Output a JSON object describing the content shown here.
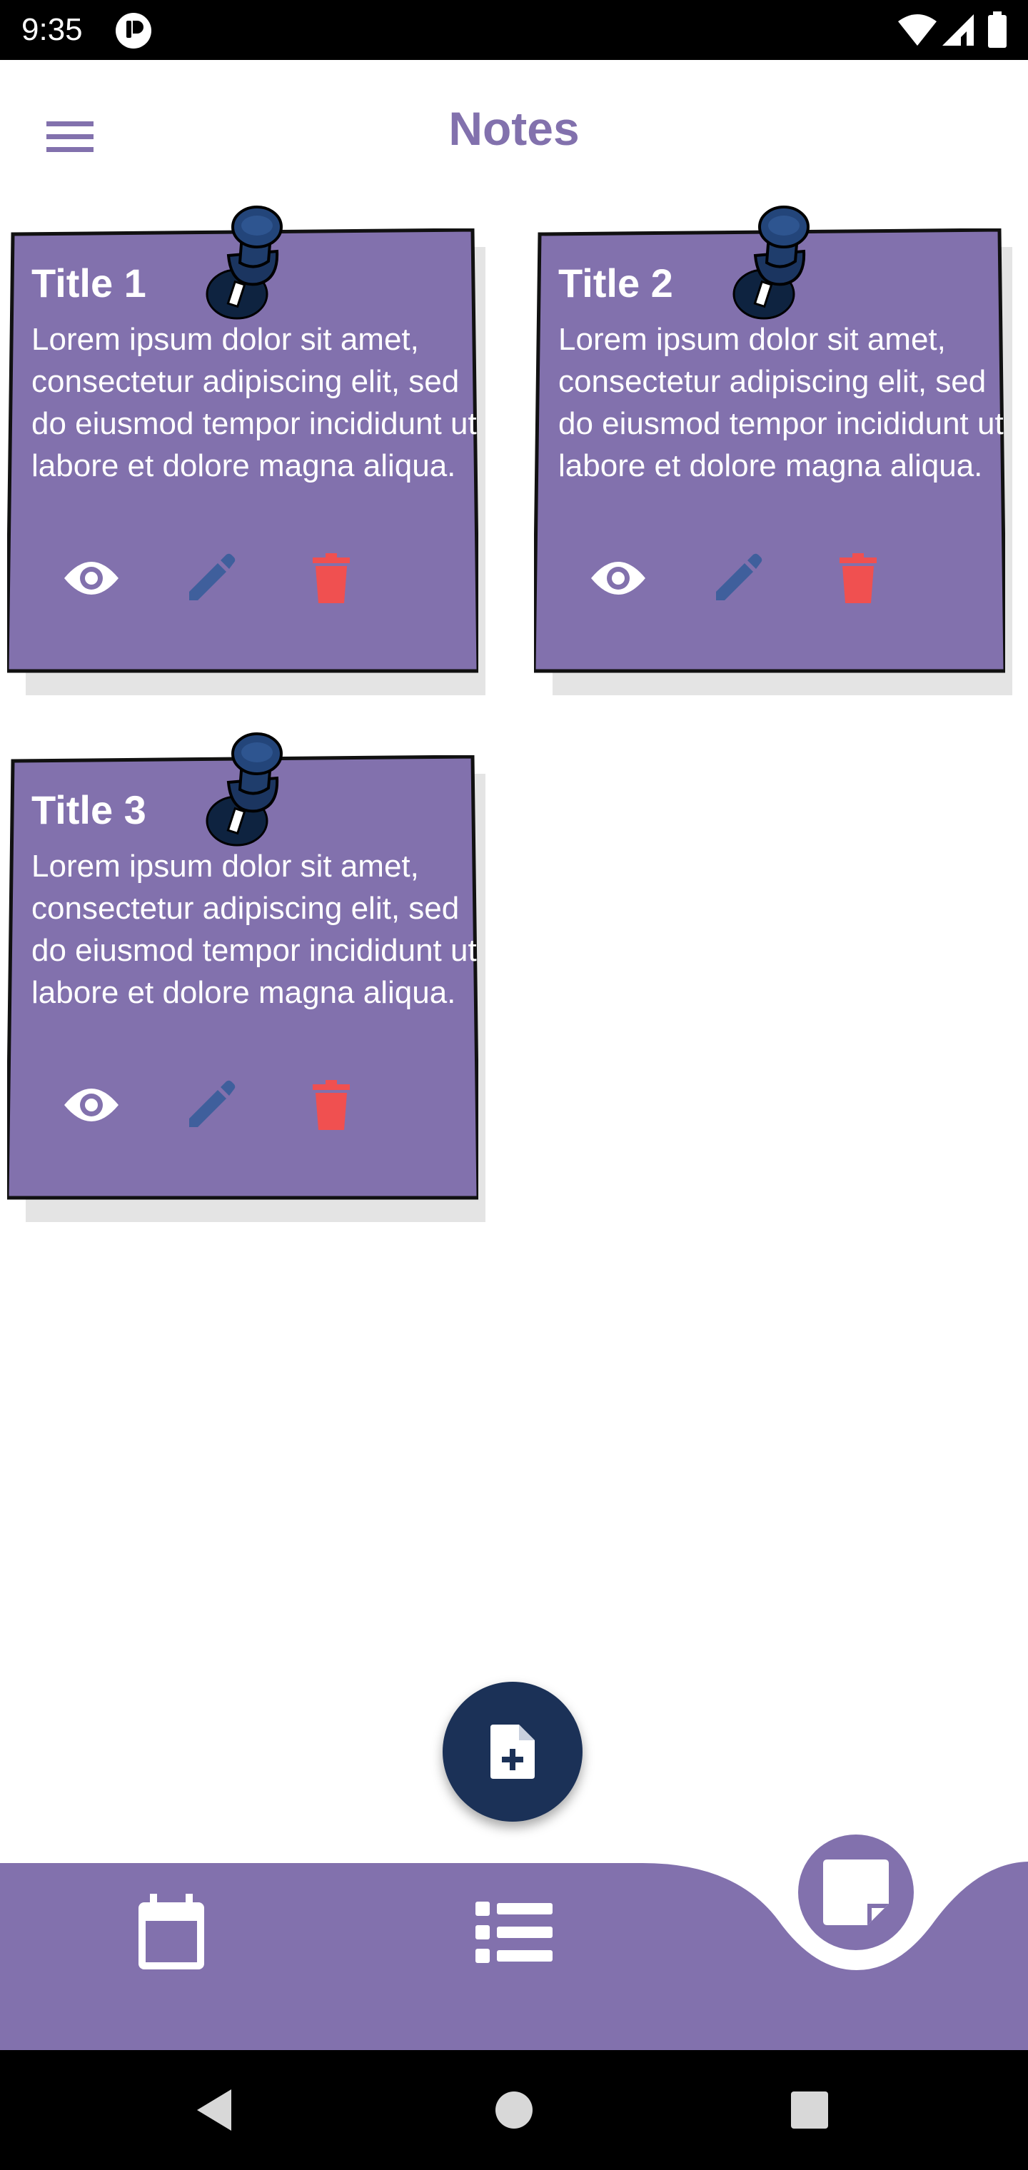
{
  "status_bar": {
    "time": "9:35",
    "icons": [
      "app-notification-icon",
      "wifi-icon",
      "signal-icon",
      "battery-icon"
    ]
  },
  "app_bar": {
    "title": "Notes",
    "menu_icon": "hamburger-menu-icon"
  },
  "notes": [
    {
      "title": "Title 1",
      "body": "Lorem ipsum dolor sit amet, consectetur adipiscing elit, sed do eiusmod tempor incididunt ut labore et dolore magna aliqua."
    },
    {
      "title": "Title 2",
      "body": "Lorem ipsum dolor sit amet, consectetur adipiscing elit, sed do eiusmod tempor incididunt ut labore et dolore magna aliqua."
    },
    {
      "title": "Title 3",
      "body": "Lorem ipsum dolor sit amet, consectetur adipiscing elit, sed do eiusmod tempor incididunt ut labore et dolore magna aliqua."
    }
  ],
  "note_actions": [
    "eye-icon",
    "pencil-icon",
    "trash-icon"
  ],
  "fab": {
    "icon": "add-document-icon"
  },
  "bottom_nav": {
    "items": [
      "calendar-icon",
      "list-icon",
      "sticky-note-icon"
    ],
    "active": "sticky-note-icon"
  },
  "system_nav": [
    "back-icon",
    "home-icon",
    "recents-icon"
  ],
  "colors": {
    "primary": "#8271ad",
    "dark_navy": "#1b3157",
    "edit_blue": "#3f5f9c",
    "delete_red": "#f05050",
    "card_shadow": "#e4e4e4"
  }
}
